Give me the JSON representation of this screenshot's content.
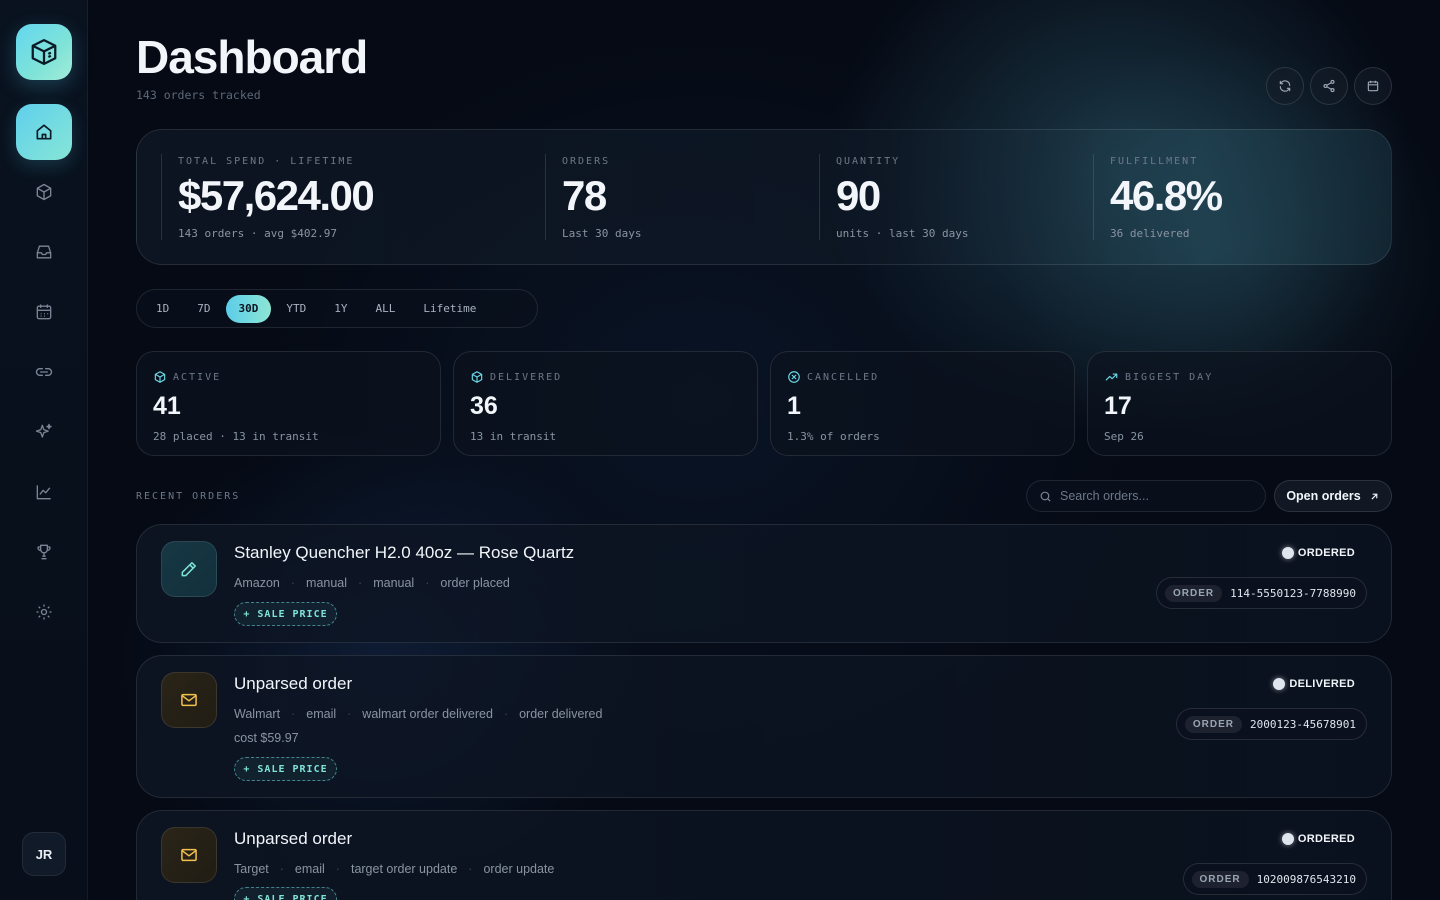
{
  "header": {
    "title": "Dashboard",
    "subtitle": "143 orders tracked"
  },
  "sidebar": {
    "logo_icon": "cube-logo-icon",
    "items": [
      {
        "name": "home",
        "icon": "home-icon",
        "active": true
      },
      {
        "name": "packages",
        "icon": "package-icon"
      },
      {
        "name": "inbox",
        "icon": "inbox-icon"
      },
      {
        "name": "calendar",
        "icon": "calendar-icon"
      },
      {
        "name": "links",
        "icon": "link-icon"
      },
      {
        "name": "sparkles",
        "icon": "sparkles-icon"
      },
      {
        "name": "analytics",
        "icon": "chart-icon"
      },
      {
        "name": "trophy",
        "icon": "trophy-icon"
      },
      {
        "name": "settings",
        "icon": "gear-icon"
      }
    ],
    "avatar_initials": "JR"
  },
  "stats": [
    {
      "label": "TOTAL SPEND · LIFETIME",
      "value": "$57,624.00",
      "note": "143 orders · avg $402.97"
    },
    {
      "label": "ORDERS",
      "value": "78",
      "note": "Last 30 days"
    },
    {
      "label": "QUANTITY",
      "value": "90",
      "note": "units · last 30 days"
    },
    {
      "label": "FULFILLMENT",
      "value": "46.8%",
      "note": "36 delivered"
    }
  ],
  "range_tabs": [
    {
      "label": "1D"
    },
    {
      "label": "7D"
    },
    {
      "label": "30D",
      "active": true
    },
    {
      "label": "YTD"
    },
    {
      "label": "1Y"
    },
    {
      "label": "ALL"
    },
    {
      "label": "Lifetime"
    }
  ],
  "cards": [
    {
      "label": "ACTIVE",
      "value": "41",
      "note": "28 placed · 13 in transit",
      "icon": "package-icon"
    },
    {
      "label": "DELIVERED",
      "value": "36",
      "note": "13 in transit",
      "icon": "package-icon"
    },
    {
      "label": "CANCELLED",
      "value": "1",
      "note": "1.3% of orders",
      "icon": "x-circle-icon"
    },
    {
      "label": "BIGGEST DAY",
      "value": "17",
      "note": "Sep 26",
      "icon": "trending-up-icon"
    }
  ],
  "recent": {
    "label": "RECENT ORDERS",
    "search_placeholder": "Search orders...",
    "open_button": "Open orders"
  },
  "orders": [
    {
      "title": "Stanley Quencher H2.0 40oz — Rose Quartz",
      "meta": [
        "Amazon",
        "manual",
        "manual",
        "order placed"
      ],
      "cost": "",
      "chip": "+ SALE PRICE",
      "status": "ORDERED",
      "order_tag": "ORDER",
      "order_id": "114-5550123-7788990",
      "icon": "pencil-icon"
    },
    {
      "title": "Unparsed order",
      "meta": [
        "Walmart",
        "email",
        "walmart order delivered",
        "order delivered"
      ],
      "cost": "cost $59.97",
      "chip": "+ SALE PRICE",
      "status": "DELIVERED",
      "order_tag": "ORDER",
      "order_id": "2000123-45678901",
      "icon": "mail-icon"
    },
    {
      "title": "Unparsed order",
      "meta": [
        "Target",
        "email",
        "target order update",
        "order update"
      ],
      "cost": "",
      "chip": "+ SALE PRICE",
      "status": "ORDERED",
      "order_tag": "ORDER",
      "order_id": "102009876543210",
      "icon": "mail-icon"
    }
  ]
}
